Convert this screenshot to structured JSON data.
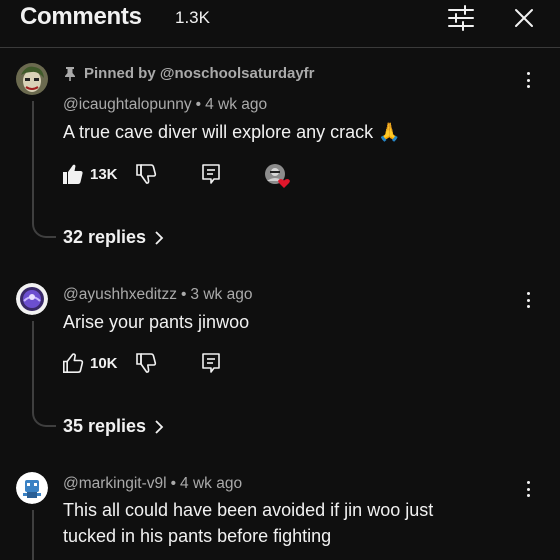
{
  "header": {
    "title": "Comments",
    "count": "1.3K"
  },
  "comments": [
    {
      "pinned_label": "Pinned by @noschoolsaturdayfr",
      "handle": "@icaughtalopunny",
      "time": "4 wk ago",
      "text": "A true cave diver will explore any crack 🙏",
      "likes": "13K",
      "liked": true,
      "replies_label": "32 replies",
      "has_creator_heart": true
    },
    {
      "handle": "@ayushhxeditzz",
      "time": "3 wk ago",
      "text": "Arise your pants jinwoo",
      "likes": "10K",
      "liked": false,
      "replies_label": "35 replies"
    },
    {
      "handle": "@markingit-v9l",
      "time": "4 wk ago",
      "text": "This all could have been avoided if jin woo just tucked in his pants before fighting"
    }
  ],
  "separator": "•"
}
